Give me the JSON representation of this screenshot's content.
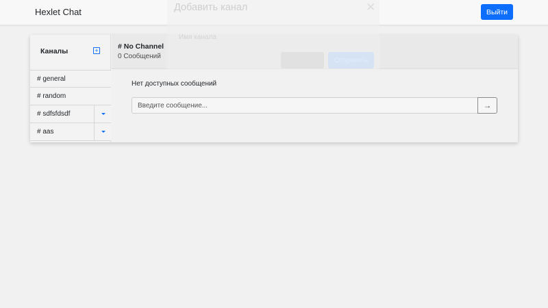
{
  "navbar": {
    "brand": "Hexlet Chat",
    "logout_label": "Выйти",
    "logout_color": "#0d6efd"
  },
  "sidebar": {
    "title": "Каналы",
    "add_icon": "plus-square-icon",
    "channels": [
      {
        "name": "# general",
        "removable": false
      },
      {
        "name": "# random",
        "removable": false
      },
      {
        "name": "# sdfsfdsdf",
        "removable": true
      },
      {
        "name": "# aas",
        "removable": true
      }
    ]
  },
  "chat": {
    "channel_title": "# No Channel",
    "message_count": "0 Сообщений",
    "empty_text": "Нет доступных сообщений",
    "input_placeholder": "Введите сообщение...",
    "send_icon": "arrow-right-icon"
  },
  "modal": {
    "title": "Добавить канал",
    "field_label": "Имя канала",
    "cancel_label": "Отменить",
    "submit_label": "Отправить",
    "close_icon": "close-icon"
  }
}
